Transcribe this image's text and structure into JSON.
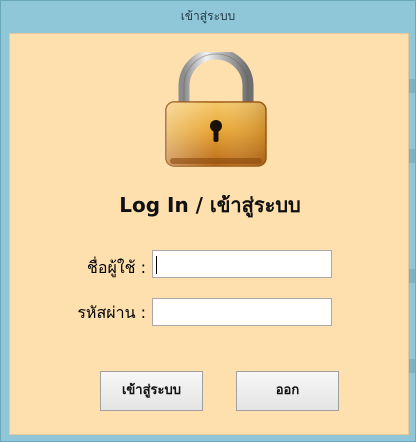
{
  "window": {
    "title": "เข้าสู่ระบบ"
  },
  "login": {
    "heading": "Log In / เข้าสู่ระบบ",
    "username_label": "ชื่อผู้ใช้ :",
    "username_value": "",
    "password_label": "รหัสผ่าน :",
    "password_value": "",
    "login_button": "เข้าสู่ระบบ",
    "exit_button": "ออก"
  },
  "icons": {
    "lock": "padlock-icon"
  },
  "colors": {
    "titlebar": "#8fc6d8",
    "form_background": "#fedfae",
    "lock_body": "#e9a22a"
  }
}
